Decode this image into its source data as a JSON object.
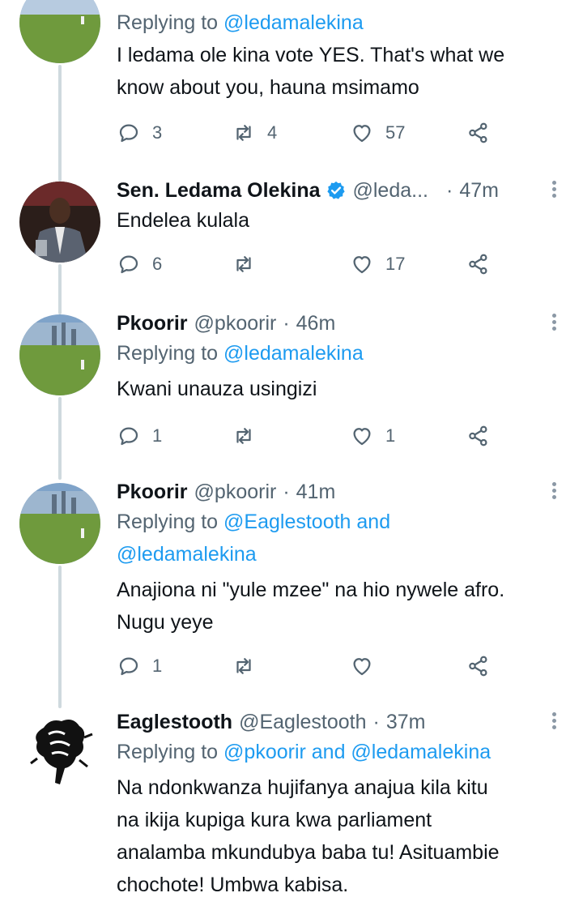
{
  "tweets": [
    {
      "name": "",
      "verified": false,
      "handle": "",
      "time": "",
      "replying_prefix": "Replying to",
      "replying_to": "@ledamalekina",
      "replying_line2": "",
      "text_lines": [
        "I ledama ole kina vote YES. That's what we",
        "know about you, hauna msimamo"
      ],
      "replies": "3",
      "retweets": "4",
      "likes": "57"
    },
    {
      "name": "Sen. Ledama Olekina",
      "verified": true,
      "handle": "@leda...",
      "time": "47m",
      "replying_prefix": "",
      "replying_to": "",
      "replying_line2": "",
      "text_lines": [
        "Endelea kulala"
      ],
      "replies": "6",
      "retweets": "",
      "likes": "17"
    },
    {
      "name": "Pkoorir",
      "verified": false,
      "handle": "@pkoorir",
      "time": "46m",
      "replying_prefix": "Replying to",
      "replying_to": "@ledamalekina",
      "replying_line2": "",
      "text_lines": [
        "Kwani unauza usingizi"
      ],
      "replies": "1",
      "retweets": "",
      "likes": "1"
    },
    {
      "name": "Pkoorir",
      "verified": false,
      "handle": "@pkoorir",
      "time": "41m",
      "replying_prefix": "Replying to",
      "replying_to": "@Eaglestooth and",
      "replying_line2": "@ledamalekina",
      "text_lines": [
        "Anajiona ni \"yule mzee\" na hio nywele afro.",
        "Nugu yeye"
      ],
      "replies": "1",
      "retweets": "",
      "likes": ""
    },
    {
      "name": "Eaglestooth",
      "verified": false,
      "handle": "@Eaglestooth",
      "time": "37m",
      "replying_prefix": "Replying to",
      "replying_to": "@pkoorir and @ledamalekina",
      "replying_line2": "",
      "text_lines": [
        "Na ndonkwanza hujifanya anajua kila kitu",
        "na ikija kupiga kura kwa parliament",
        "analamba mkundubya baba tu! Asituambie",
        "chochote! Umbwa kabisa."
      ],
      "replies": "",
      "retweets": "",
      "likes": ""
    }
  ],
  "separator": "·",
  "icons": {
    "reply": "reply-icon",
    "retweet": "retweet-icon",
    "like": "heart-icon",
    "share": "share-icon",
    "verified": "verified-badge-icon",
    "more": "more-dots-icon"
  },
  "colors": {
    "link": "#1d9bf0",
    "secondary_text": "#536471",
    "thread_line": "#cfd9de",
    "verified": "#1d9bf0"
  }
}
